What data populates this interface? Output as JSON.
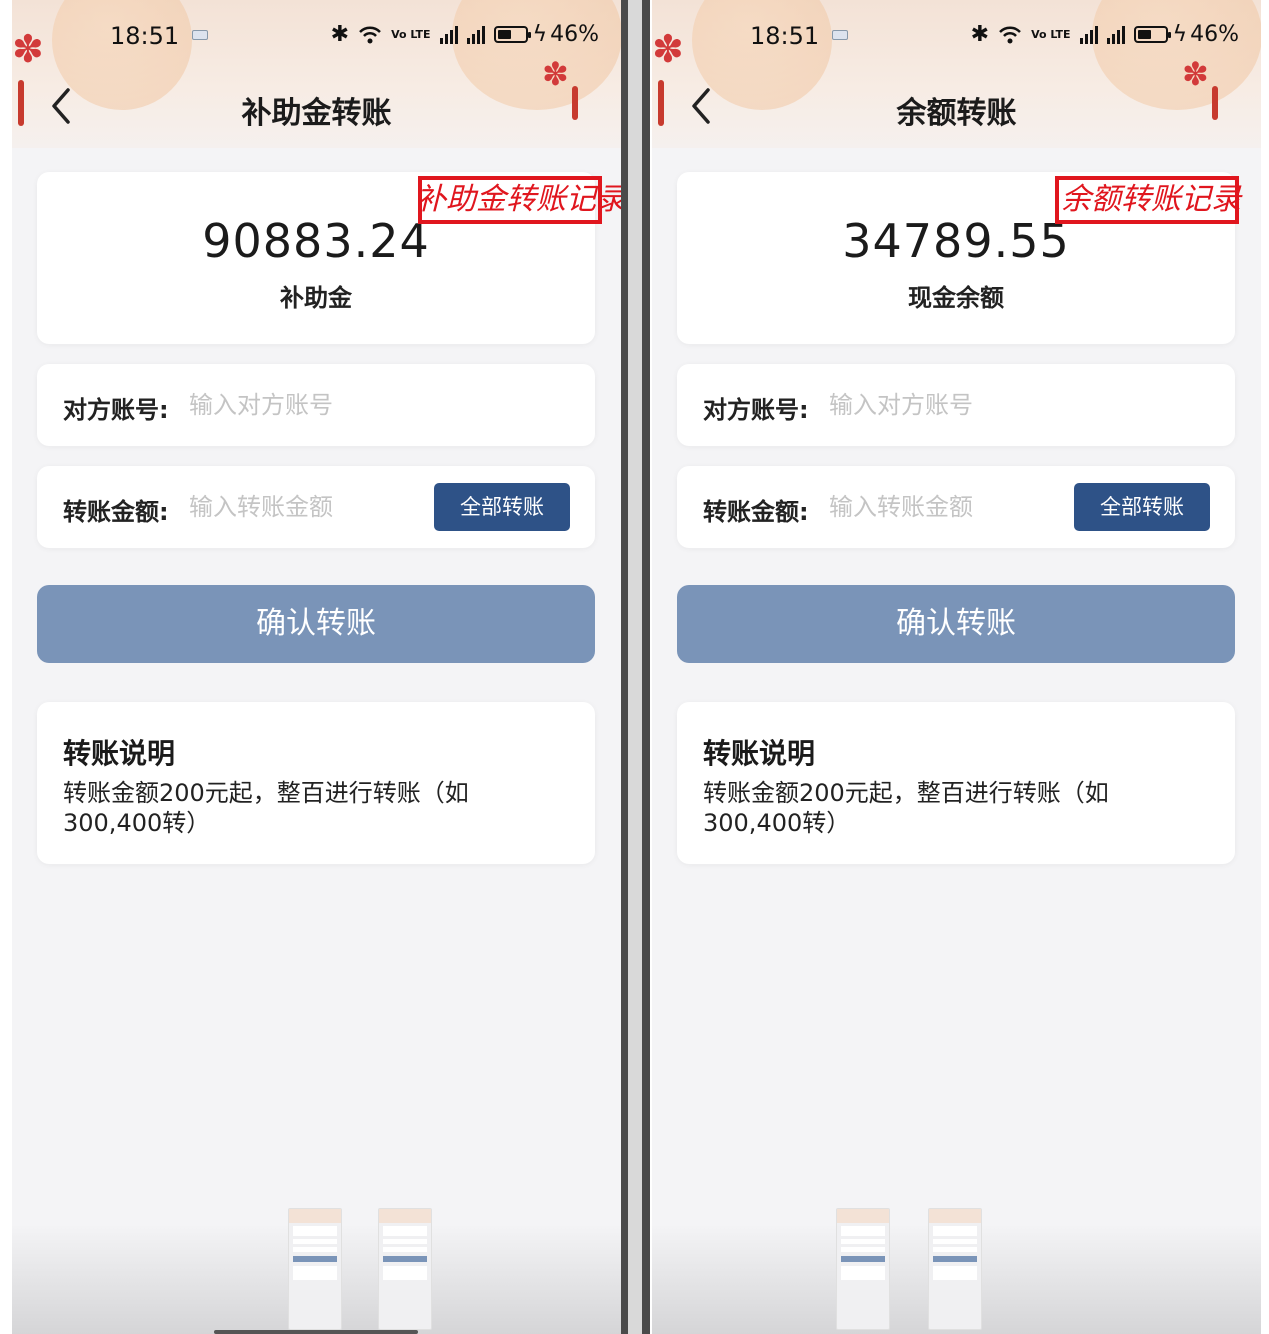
{
  "status_bar": {
    "time": "18:51",
    "volte_label": "Vo LTE",
    "battery_pct": "46%"
  },
  "screens": [
    {
      "title": "补助金转账",
      "record_link": "补助金转账记录",
      "balance_value": "90883.24",
      "balance_label": "补助金",
      "account": {
        "label": "对方账号:",
        "placeholder": "输入对方账号"
      },
      "amount": {
        "label": "转账金额:",
        "placeholder": "输入转账金额",
        "all_button": "全部转账"
      },
      "confirm_button": "确认转账",
      "notes": {
        "title": "转账说明",
        "text": "转账金额200元起，整百进行转账（如300,400转）"
      }
    },
    {
      "title": "余额转账",
      "record_link": "余额转账记录",
      "balance_value": "34789.55",
      "balance_label": "现金余额",
      "account": {
        "label": "对方账号:",
        "placeholder": "输入对方账号"
      },
      "amount": {
        "label": "转账金额:",
        "placeholder": "输入转账金额",
        "all_button": "全部转账"
      },
      "confirm_button": "确认转账",
      "notes": {
        "title": "转账说明",
        "text": "转账金额200元起，整百进行转账（如300,400转）"
      }
    }
  ],
  "colors": {
    "primary_button": "#2e5287",
    "confirm_button_disabled": "#7a94b8",
    "annotation_red": "#e0161e",
    "page_bg": "#f4f4f6"
  },
  "icons": [
    "back-chevron-icon",
    "bluetooth-icon",
    "wifi-icon",
    "signal-icon",
    "battery-icon",
    "charging-icon",
    "chinese-knot-icon"
  ]
}
